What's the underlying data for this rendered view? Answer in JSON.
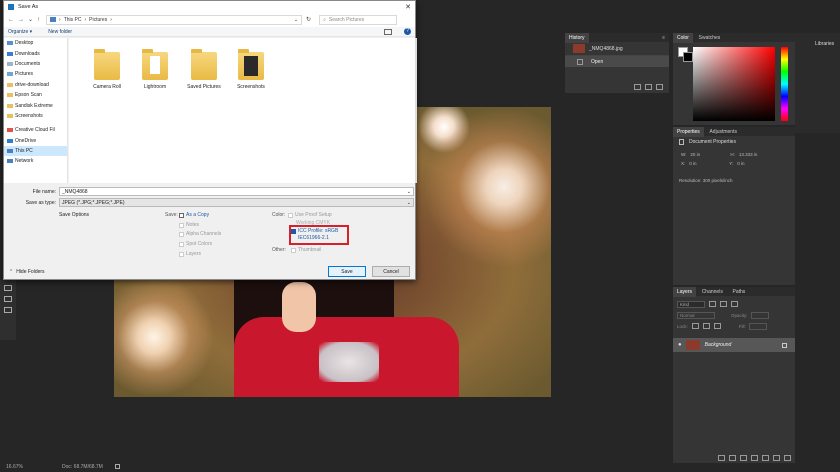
{
  "photoshop": {
    "history_panel": {
      "tab": "History",
      "snapshot_label": "_NMQ4868.jpg",
      "state_label": "Open"
    },
    "color_panel": {
      "tabs": [
        "Color",
        "Swatches"
      ],
      "libraries_label": "Libraries"
    },
    "properties_panel": {
      "tabs": [
        "Properties",
        "Adjustments"
      ],
      "header": "Document Properties",
      "width_label": "W:",
      "width_value": "20 in",
      "height_label": "H:",
      "height_value": "13.333 in",
      "x_label": "X:",
      "x_value": "0 in",
      "y_label": "Y:",
      "y_value": "0 in",
      "resolution": "Resolution: 300 pixels/inch"
    },
    "layers_panel": {
      "tabs": [
        "Layers",
        "Channels",
        "Paths"
      ],
      "kind_label": "Kind",
      "mode_label": "Normal",
      "opacity_label": "Opacity:",
      "lock_label": "Lock:",
      "fill_label": "Fill:",
      "layer_name": "Background"
    },
    "status": {
      "zoom": "16.67%",
      "doc": "Doc: 68.7M/68.7M"
    }
  },
  "dialog": {
    "title": "Save As",
    "breadcrumb": [
      "This PC",
      "Pictures"
    ],
    "search_placeholder": "Search Pictures",
    "toolbar": {
      "organize": "Organize ▾",
      "new_folder": "New folder"
    },
    "nav_items": [
      "Desktop",
      "Downloads",
      "Documents",
      "Pictures",
      "drive-download",
      "Epson Scan",
      "Sandisk Extreme",
      "Screenshots",
      "Creative Cloud Fil",
      "OneDrive",
      "This PC",
      "Network"
    ],
    "folders": [
      "Camera Roll",
      "Lightroom",
      "Saved Pictures",
      "Screenshots"
    ],
    "file_name_label": "File name:",
    "file_name_value": "_NMQ4868",
    "save_type_label": "Save as type:",
    "save_type_value": "JPEG (*.JPG;*.JPEG;*.JPE)",
    "save_options_label": "Save Options",
    "save_label": "Save:",
    "save_opts": [
      "As a Copy",
      "Notes",
      "Alpha Channels",
      "Spot Colors",
      "Layers"
    ],
    "color_label": "Color:",
    "use_proof": "Use Proof Setup",
    "working_cmyk": "Working CMYK",
    "icc_line1": "ICC Profile: sRGB",
    "icc_line2": "IEC61966-2.1",
    "other_label": "Other:",
    "thumbnail": "Thumbnail",
    "hide_folders": "Hide Folders",
    "save_button": "Save",
    "cancel_button": "Cancel"
  }
}
